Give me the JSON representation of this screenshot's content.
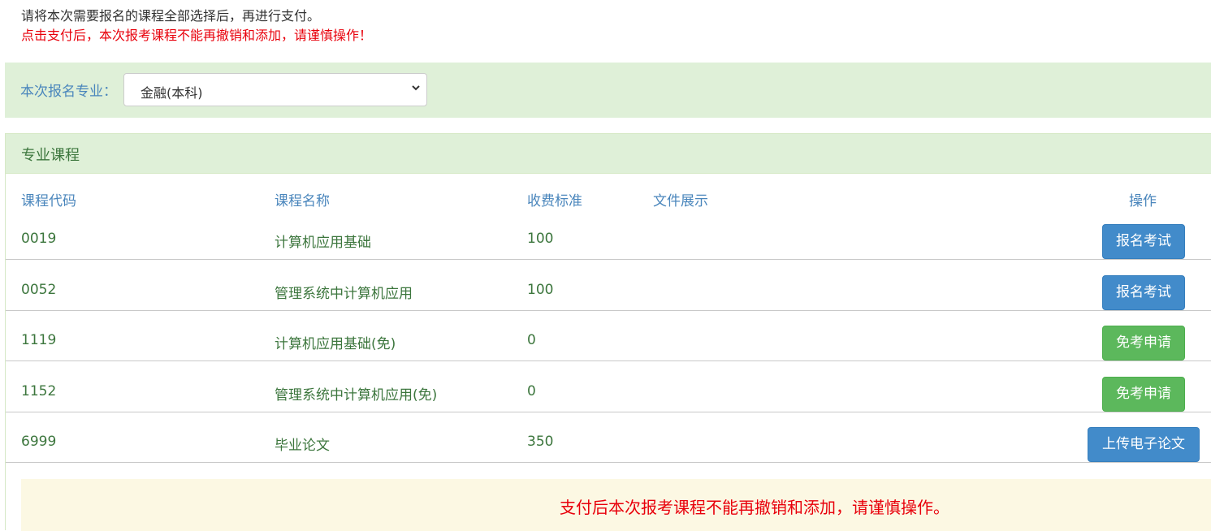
{
  "notice": {
    "line1": "请将本次需要报名的课程全部选择后，再进行支付。",
    "line2": "点击支付后，本次报考课程不能再撤销和添加，请谨慎操作！"
  },
  "major": {
    "label": "本次报名专业：",
    "selected": "金融(本科)"
  },
  "panel": {
    "title": "专业课程",
    "headers": [
      "课程代码",
      "课程名称",
      "收费标准",
      "文件展示",
      "操作"
    ],
    "rows": [
      {
        "code": "0019",
        "name": "计算机应用基础",
        "fee": "100",
        "action": "报名考试"
      },
      {
        "code": "0052",
        "name": "管理系统中计算机应用",
        "fee": "100",
        "action": "报名考试"
      },
      {
        "code": "1119",
        "name": "计算机应用基础(免)",
        "fee": "0",
        "action": "免考申请"
      },
      {
        "code": "1152",
        "name": "管理系统中计算机应用(免)",
        "fee": "0",
        "action": "免考申请"
      },
      {
        "code": "6999",
        "name": "毕业论文",
        "fee": "350",
        "action": "上传电子论文"
      }
    ]
  },
  "warning": "支付后本次报考课程不能再撤销和添加，请谨慎操作。",
  "colors": {
    "success_bg": "#dff0d8",
    "primary": "#428bca",
    "green": "#5cb85c",
    "danger": "#e8000b",
    "warning_bg": "#fcf8e3"
  }
}
